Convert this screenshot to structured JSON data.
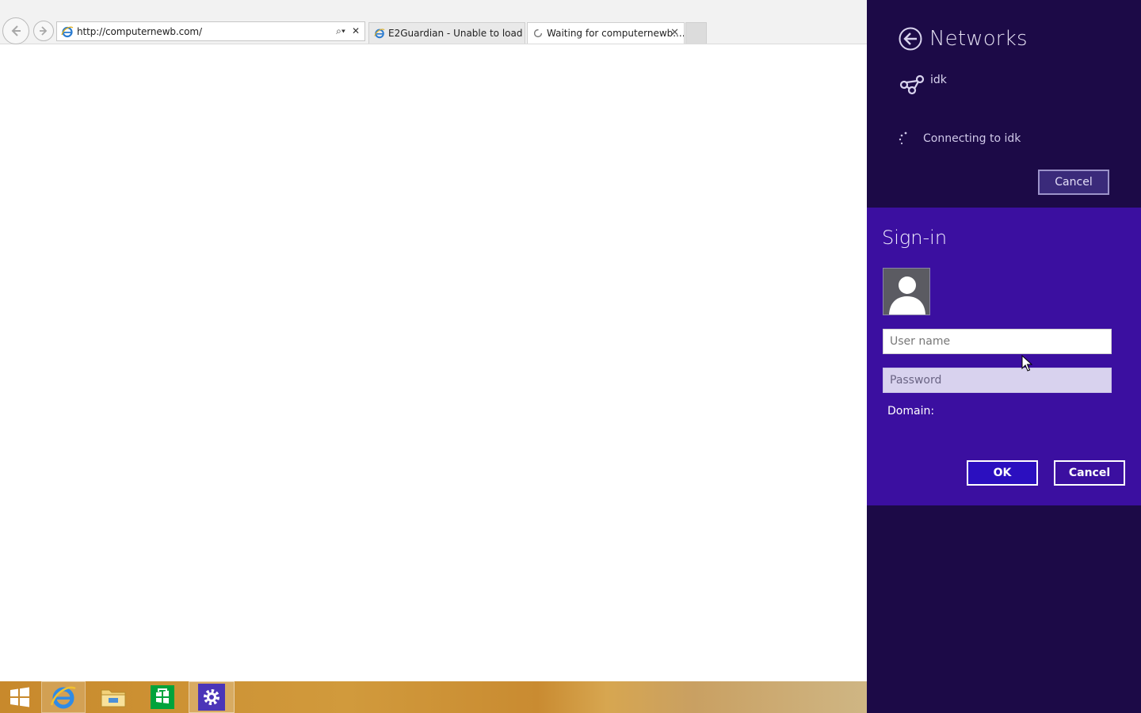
{
  "browser": {
    "address_url": "http://computernewb.com/",
    "tabs": [
      {
        "label": "E2Guardian - Unable to load w...",
        "icon": "ie-page-icon"
      },
      {
        "label": "Waiting for computernewb....",
        "icon": "loading-spinner-icon"
      }
    ]
  },
  "taskbar": {
    "items": [
      "start-icon",
      "internet-explorer-icon",
      "file-explorer-icon",
      "store-icon",
      "settings-icon"
    ]
  },
  "networks": {
    "title": "Networks",
    "network_name": "idk",
    "status": "Connecting to idk",
    "cancel_label": "Cancel"
  },
  "signin": {
    "title": "Sign-in",
    "username_placeholder": "User name",
    "password_placeholder": "Password",
    "domain_label": "Domain:",
    "ok_label": "OK",
    "cancel_label": "Cancel"
  },
  "colors": {
    "charms_bg": "#1c0a47",
    "signin_bg": "#3b0fa0",
    "ok_bg": "#2b0fbf",
    "taskbar": "#c8892c"
  }
}
